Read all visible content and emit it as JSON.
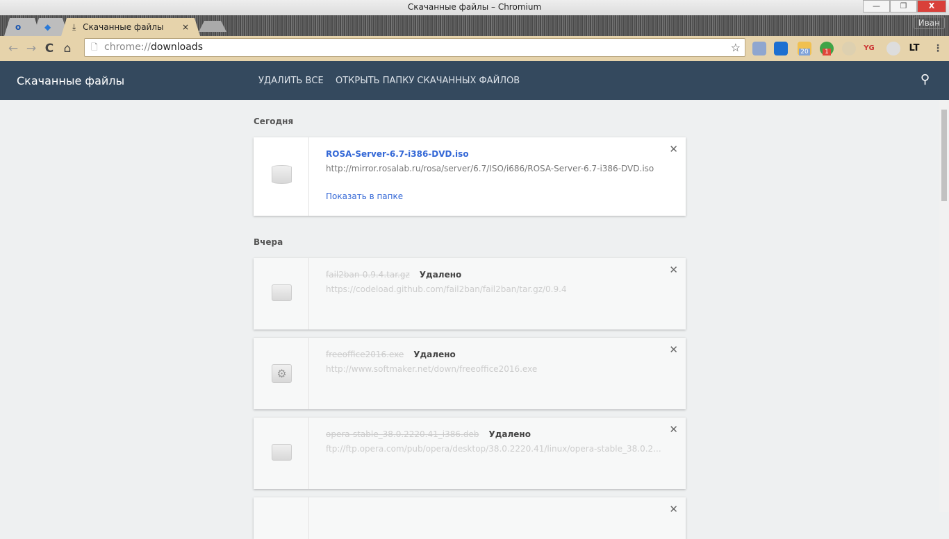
{
  "window": {
    "title": "Скачанные файлы – Chromium",
    "minimize": "—",
    "restore": "❐",
    "close": "X",
    "user": "Иван"
  },
  "tabs": [
    {
      "label": "o"
    },
    {
      "label": "◆"
    },
    {
      "label": "Скачанные файлы",
      "close": "×",
      "icon": "⤓"
    }
  ],
  "toolbar": {
    "back": "←",
    "forward": "→",
    "reload": "C",
    "home": "⌂",
    "url_scheme": "chrome://",
    "url_path": "downloads",
    "star": "☆",
    "menu": "⋮",
    "extensions": [
      {
        "name": "mail",
        "badge": ""
      },
      {
        "name": "target",
        "badge": ""
      },
      {
        "name": "weather",
        "badge": "20"
      },
      {
        "name": "pushbullet",
        "badge": "1"
      },
      {
        "name": "blank",
        "badge": ""
      },
      {
        "name": "yg",
        "badge": "YG"
      },
      {
        "name": "disc",
        "badge": ""
      },
      {
        "name": "languagetool",
        "badge": "LT"
      }
    ]
  },
  "header": {
    "title": "Скачанные файлы",
    "clear_all": "УДАЛИТЬ ВСЕ",
    "open_folder": "ОТКРЫТЬ ПАПКУ СКАЧАННЫХ ФАЙЛОВ",
    "search": "⚲"
  },
  "sections": {
    "today": "Сегодня",
    "yesterday": "Вчера"
  },
  "downloads": [
    {
      "name": "ROSA-Server-6.7-i386-DVD.iso",
      "url": "http://mirror.rosalab.ru/rosa/server/6.7/ISO/i686/ROSA-Server-6.7-i386-DVD.iso",
      "action": "Показать в папке",
      "status": ""
    },
    {
      "name": "fail2ban-0.9.4.tar.gz",
      "url": "https://codeload.github.com/fail2ban/fail2ban/tar.gz/0.9.4",
      "status": "Удалено"
    },
    {
      "name": "freeoffice2016.exe",
      "url": "http://www.softmaker.net/down/freeoffice2016.exe",
      "status": "Удалено"
    },
    {
      "name": "opera-stable_38.0.2220.41_i386.deb",
      "url": "ftp://ftp.opera.com/pub/opera/desktop/38.0.2220.41/linux/opera-stable_38.0.2...",
      "status": "Удалено"
    }
  ],
  "close_glyph": "✕"
}
